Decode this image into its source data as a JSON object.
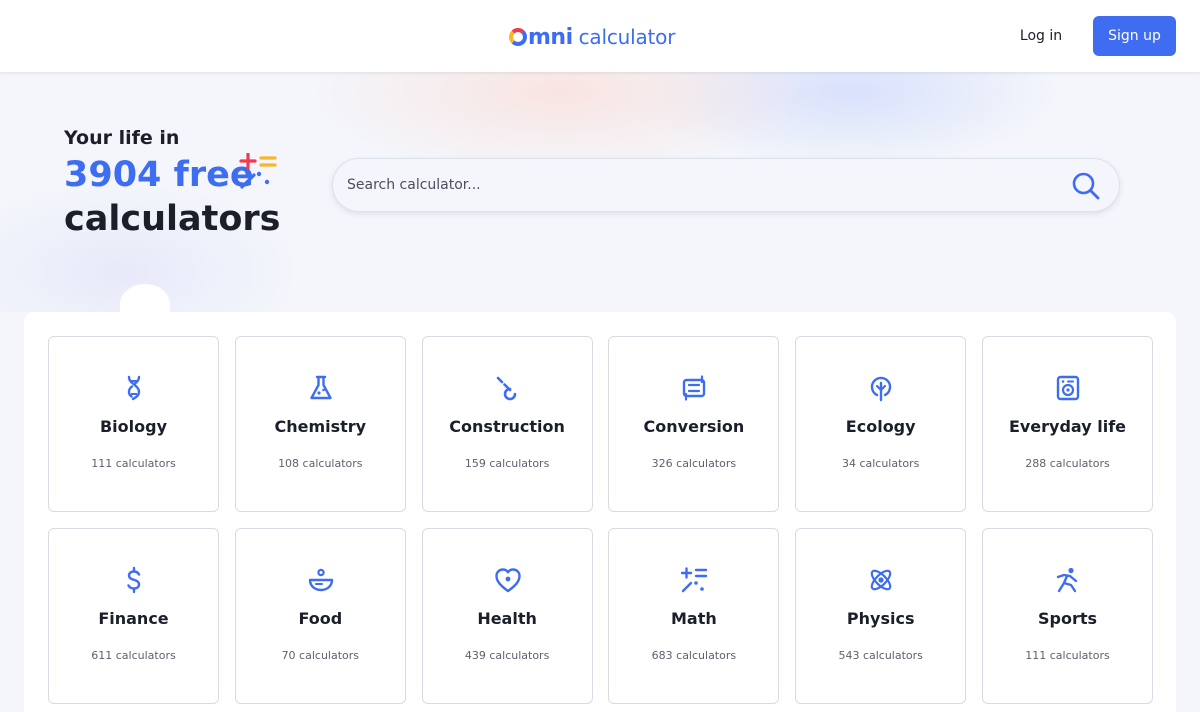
{
  "header": {
    "logo_mark": "mni",
    "logo_text": "calculator",
    "login_label": "Log in",
    "signup_label": "Sign up"
  },
  "hero": {
    "line1": "Your life in",
    "line2": "3904 free",
    "line3": "calculators"
  },
  "search": {
    "placeholder": "Search calculator..."
  },
  "colors": {
    "accent": "#3f6df1",
    "text": "#1b1f2a",
    "background": "#f4f6fb"
  },
  "categories": [
    {
      "name": "Biology",
      "count": "111 calculators",
      "icon": "dna-icon"
    },
    {
      "name": "Chemistry",
      "count": "108 calculators",
      "icon": "flask-icon"
    },
    {
      "name": "Construction",
      "count": "159 calculators",
      "icon": "wrench-icon"
    },
    {
      "name": "Conversion",
      "count": "326 calculators",
      "icon": "conversion-icon"
    },
    {
      "name": "Ecology",
      "count": "34 calculators",
      "icon": "tree-icon"
    },
    {
      "name": "Everyday life",
      "count": "288 calculators",
      "icon": "washing-machine-icon"
    },
    {
      "name": "Finance",
      "count": "611 calculators",
      "icon": "dollar-icon"
    },
    {
      "name": "Food",
      "count": "70 calculators",
      "icon": "bowl-icon"
    },
    {
      "name": "Health",
      "count": "439 calculators",
      "icon": "heart-icon"
    },
    {
      "name": "Math",
      "count": "683 calculators",
      "icon": "math-icon"
    },
    {
      "name": "Physics",
      "count": "543 calculators",
      "icon": "atom-icon"
    },
    {
      "name": "Sports",
      "count": "111 calculators",
      "icon": "runner-icon"
    }
  ]
}
